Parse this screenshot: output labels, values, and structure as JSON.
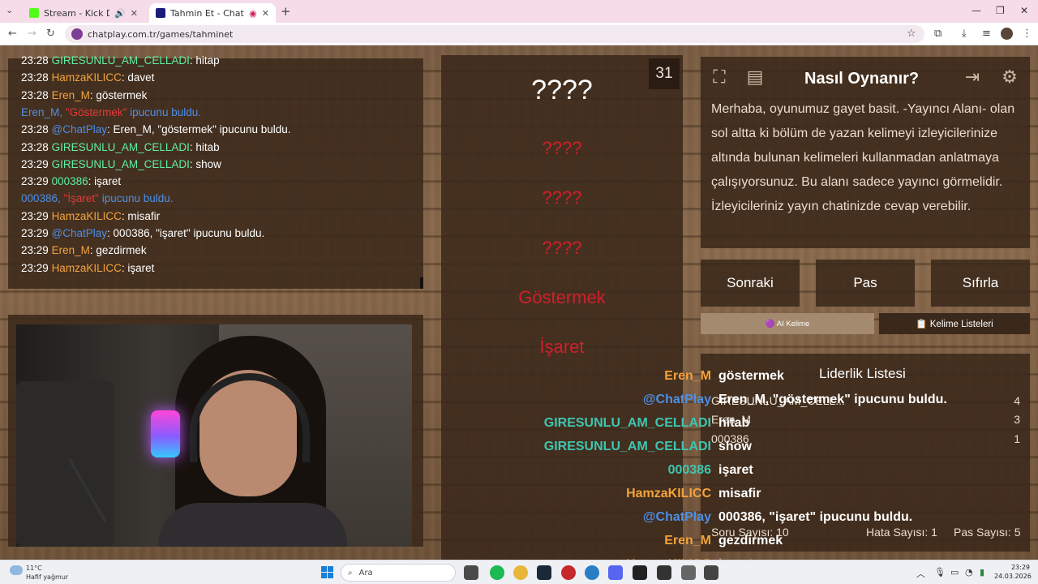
{
  "browser": {
    "tabs": [
      {
        "title": "Stream - Kick Dashboard",
        "active": false,
        "fav_color": "#53fc18"
      },
      {
        "title": "Tahmin Et - ChatPlay",
        "active": true,
        "fav_color": "#7e3d96"
      }
    ],
    "url": "chatplay.com.tr/games/tahminet"
  },
  "chat_log": [
    {
      "time": "23:28",
      "user": "GIRESUNLU_AM_CELLADI",
      "user_color": "green",
      "text": ": hitap"
    },
    {
      "time": "23:28",
      "user": "HamzaKILICC",
      "user_color": "orange",
      "text": ": davet"
    },
    {
      "time": "23:28",
      "user": "Eren_M",
      "user_color": "orange",
      "text": ": göstermek"
    },
    {
      "time": "",
      "user": "Eren_M,",
      "user_color": "blue",
      "word": "\"Göstermek\"",
      "text": " ipucunu buldu."
    },
    {
      "time": "23:28",
      "user": "@ChatPlay",
      "user_color": "blue",
      "text": ": Eren_M, \"göstermek\" ipucunu buldu."
    },
    {
      "time": "23:28",
      "user": "GIRESUNLU_AM_CELLADI",
      "user_color": "green",
      "text": ": hitab"
    },
    {
      "time": "23:29",
      "user": "GIRESUNLU_AM_CELLADI",
      "user_color": "green",
      "text": ": show"
    },
    {
      "time": "23:29",
      "user": "000386",
      "user_color": "green",
      "text": ": işaret"
    },
    {
      "time": "",
      "user": "000386,",
      "user_color": "blue",
      "word": "\"İşaret\"",
      "text": " ipucunu buldu."
    },
    {
      "time": "23:29",
      "user": "HamzaKILICC",
      "user_color": "orange",
      "text": ": misafir"
    },
    {
      "time": "23:29",
      "user": "@ChatPlay",
      "user_color": "blue",
      "text": ": 000386, \"işaret\" ipucunu buldu."
    },
    {
      "time": "23:29",
      "user": "Eren_M",
      "user_color": "orange",
      "text": ": gezdirmek"
    },
    {
      "time": "23:29",
      "user": "HamzaKILICC",
      "user_color": "orange",
      "text": ": işaret"
    }
  ],
  "game": {
    "timer": "31",
    "main_word": "????",
    "hints": [
      "????",
      "????",
      "????",
      "Göstermek",
      "İşaret"
    ]
  },
  "help": {
    "title": "Nasıl Oynanır?",
    "text": "Merhaba, oyunumuz gayet basit. -Yayıncı Alanı- olan sol altta ki bölüm de yazan kelimeyi izleyicilerinize altında bulunan kelimeleri kullanmadan anlatmaya çalışıyorsunuz. Bu alanı sadece yayıncı görmelidir. İzleyicileriniz yayın chatinizde cevap verebilir."
  },
  "buttons": {
    "next": "Sonraki",
    "pass": "Pas",
    "reset": "Sıfırla"
  },
  "mode_tabs": {
    "ai": "🟣 AI Kelime",
    "lists": "📋 Kelime Listeleri"
  },
  "leaderboard": {
    "title": "Liderlik Listesi",
    "rows": [
      {
        "name": "GIRESUNLU_AM_CELL...",
        "score": "4"
      },
      {
        "name": "Eren_M",
        "score": "3"
      },
      {
        "name": "000386",
        "score": "1"
      }
    ],
    "questions_label": "Soru Sayısı: 10",
    "errors_label": "Hata Sayısı: 1",
    "passes_label": "Pas Sayısı: 5"
  },
  "overlay_chat": [
    {
      "user": "Eren_M",
      "color": "#f4a33c",
      "text": "göstermek"
    },
    {
      "user": "@ChatPlay",
      "color": "#4d8fe6",
      "text": "Eren_M, \"göstermek\" ipucunu buldu."
    },
    {
      "user": "GIRESUNLU_AM_CELLADI",
      "color": "#3ec6b0",
      "text": "hitab"
    },
    {
      "user": "GIRESUNLU_AM_CELLADI",
      "color": "#3ec6b0",
      "text": "show"
    },
    {
      "user": "000386",
      "color": "#3ec6b0",
      "text": "işaret"
    },
    {
      "user": "HamzaKILICC",
      "color": "#f4a33c",
      "text": "misafir"
    },
    {
      "user": "@ChatPlay",
      "color": "#4d8fe6",
      "text": "000386, \"işaret\" ipucunu buldu."
    },
    {
      "user": "Eren_M",
      "color": "#f4a33c",
      "text": "gezdirmek"
    },
    {
      "user": "HamzaKILICC",
      "color": "#f4a33c",
      "text": "işaret"
    }
  ],
  "taskbar": {
    "weather_temp": "11°C",
    "weather_desc": "Hafif yağmur",
    "search_placeholder": "Ara",
    "time": "23:29",
    "date": "24.03.2026"
  }
}
